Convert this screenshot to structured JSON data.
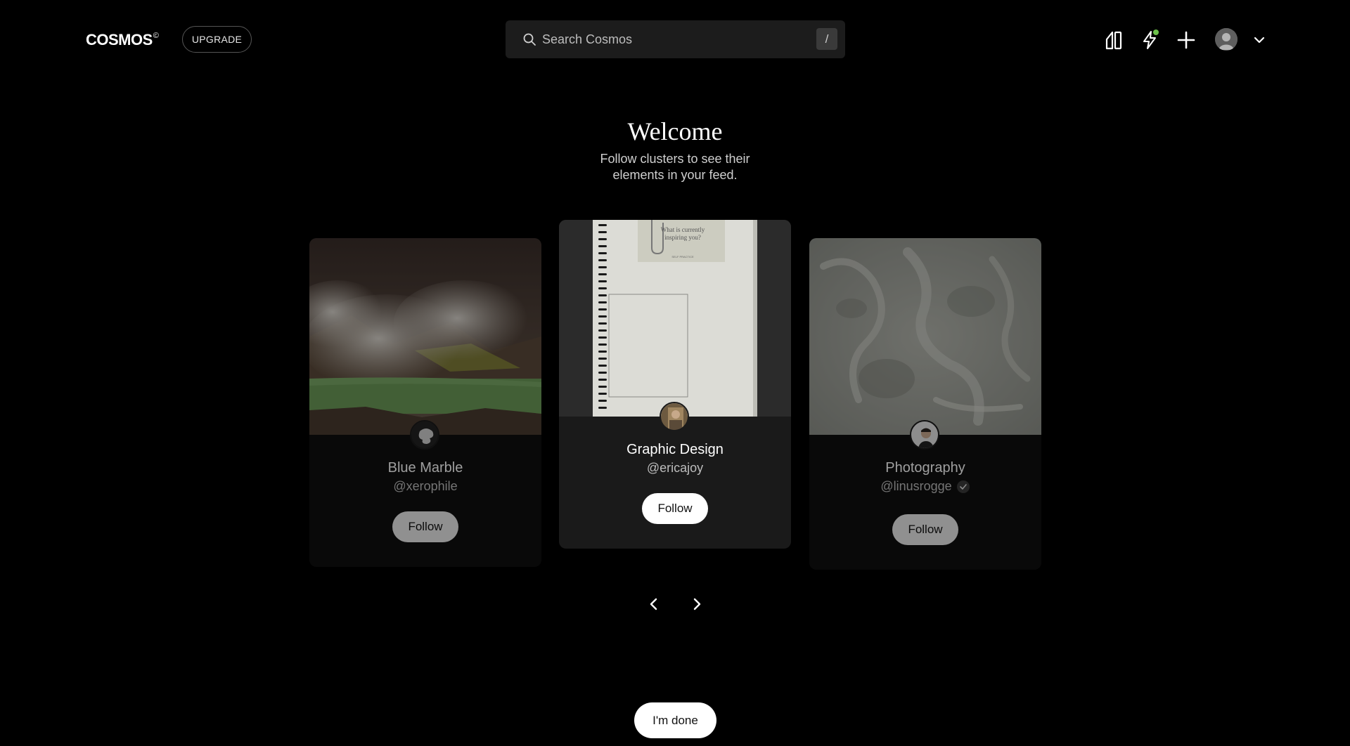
{
  "header": {
    "logo_text": "COSMOS",
    "logo_mark": "©",
    "upgrade_label": "UPGRADE",
    "search": {
      "placeholder": "Search Cosmos",
      "shortcut_key": "/"
    },
    "icons": [
      "compare-icon",
      "bolt-icon",
      "plus-icon",
      "avatar",
      "chevron-down-icon"
    ],
    "notification_dot_color": "#6cc04a"
  },
  "welcome": {
    "title": "Welcome",
    "subtitle": "Follow clusters to see their elements in your feed."
  },
  "cards": [
    {
      "name": "Blue Marble",
      "handle": "@xerophile",
      "follow_label": "Follow",
      "verified": false
    },
    {
      "name": "Graphic Design",
      "handle": "@ericajoy",
      "follow_label": "Follow",
      "verified": false,
      "cover_text": {
        "line1": "What is currently",
        "line2": "inspiring you?",
        "line3": "SELF PRACTICE"
      }
    },
    {
      "name": "Photography",
      "handle": "@linusrogge",
      "follow_label": "Follow",
      "verified": true
    }
  ],
  "done_label": "I'm done"
}
